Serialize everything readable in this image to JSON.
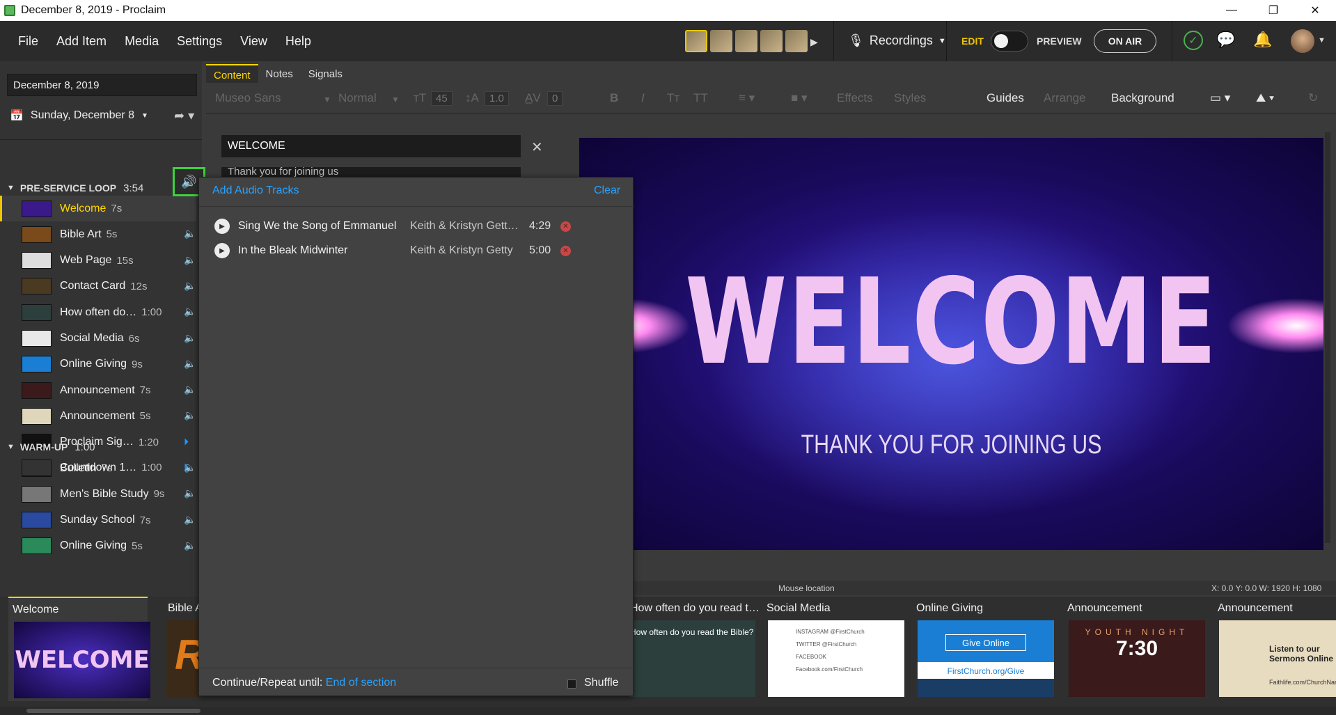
{
  "window": {
    "title": "December 8, 2019 - Proclaim",
    "controls": [
      "—",
      "❐",
      "✕"
    ]
  },
  "menu": [
    "File",
    "Add Item",
    "Media",
    "Settings",
    "View",
    "Help"
  ],
  "header": {
    "recordings_label": "Recordings",
    "edit_label": "EDIT",
    "preview_label": "PREVIEW",
    "on_air_label": "ON AIR",
    "edit_mode_on": true
  },
  "left": {
    "date_value": "December 8, 2019",
    "service_label": "Sunday, December 8",
    "sections": [
      {
        "name": "PRE-SERVICE LOOP",
        "duration": "3:54"
      },
      {
        "name": "WARM-UP",
        "duration": "1:00"
      }
    ],
    "items": [
      {
        "label": "Welcome",
        "dur": "7s",
        "active": true
      },
      {
        "label": "Bible Art",
        "dur": "5s"
      },
      {
        "label": "Web Page",
        "dur": "15s"
      },
      {
        "label": "Contact Card",
        "dur": "12s"
      },
      {
        "label": "How often do…",
        "dur": "1:00"
      },
      {
        "label": "Social Media",
        "dur": "6s"
      },
      {
        "label": "Online Giving",
        "dur": "9s"
      },
      {
        "label": "Announcement",
        "dur": "7s"
      },
      {
        "label": "Announcement",
        "dur": "5s"
      },
      {
        "label": "Proclaim Sig…",
        "dur": "1:20"
      },
      {
        "label": "Bulletin",
        "dur": "7s"
      },
      {
        "label": "Men's Bible Study",
        "dur": "9s"
      },
      {
        "label": "Sunday School",
        "dur": "7s"
      },
      {
        "label": "Online Giving",
        "dur": "5s"
      },
      {
        "label": "Countdown 1…",
        "dur": "1:00"
      }
    ]
  },
  "editor": {
    "tabs": [
      "Content",
      "Notes",
      "Signals"
    ],
    "active_tab": "Content",
    "toolbar": {
      "font": "Museo Sans",
      "weight": "Normal",
      "size": "45",
      "line_spacing": "1.0",
      "char_spacing": "0",
      "bold": "B",
      "italic": "I",
      "effects": "Effects",
      "styles": "Styles",
      "guides": "Guides",
      "arrange": "Arrange",
      "background": "Background"
    },
    "content_field_1": "WELCOME",
    "content_field_2": "Thank you for joining us"
  },
  "canvas": {
    "headline": "WELCOME",
    "subtitle": "THANK YOU FOR JOINING US"
  },
  "status": {
    "mouse_location": "Mouse location",
    "coords": "X: 0.0  Y: 0.0    W: 1920  H: 1080"
  },
  "filmstrip": [
    {
      "title": "Welcome",
      "thumb_text": "WELCOME",
      "active": true
    },
    {
      "title": "Bible Art",
      "thumb_text": "R"
    },
    {
      "title": "How often do you read t…",
      "thumb_text": "How often do you read the Bible?"
    },
    {
      "title": "Social Media",
      "thumb_text": "INSTAGRAM @FirstChurch  TWITTER @FirstChurch  FACEBOOK Facebook.com/FirstChurch"
    },
    {
      "title": "Online Giving",
      "thumb_text": "Give Online",
      "thumb_sub": "FirstChurch.org/Give"
    },
    {
      "title": "Announcement",
      "thumb_text": "7:30",
      "thumb_sub": "YOUTH NIGHT"
    },
    {
      "title": "Announcement",
      "thumb_text": "Listen to our Sermons Online",
      "thumb_sub": "Faithlife.com/ChurchName"
    }
  ],
  "audio_panel": {
    "add_label": "Add Audio Tracks",
    "clear_label": "Clear",
    "tracks": [
      {
        "title": "Sing We the Song of Emmanuel",
        "artist": "Keith & Kristyn Gett…",
        "duration": "4:29"
      },
      {
        "title": "In the Bleak Midwinter",
        "artist": "Keith & Kristyn Getty",
        "duration": "5:00"
      }
    ],
    "continue_label": "Continue/Repeat until:",
    "continue_value": "End of section",
    "shuffle_label": "Shuffle"
  },
  "colors": {
    "accent": "#ffd700",
    "link": "#29a3ff",
    "highlight_box": "#3cd23c",
    "on_air_check": "#4caf50"
  }
}
